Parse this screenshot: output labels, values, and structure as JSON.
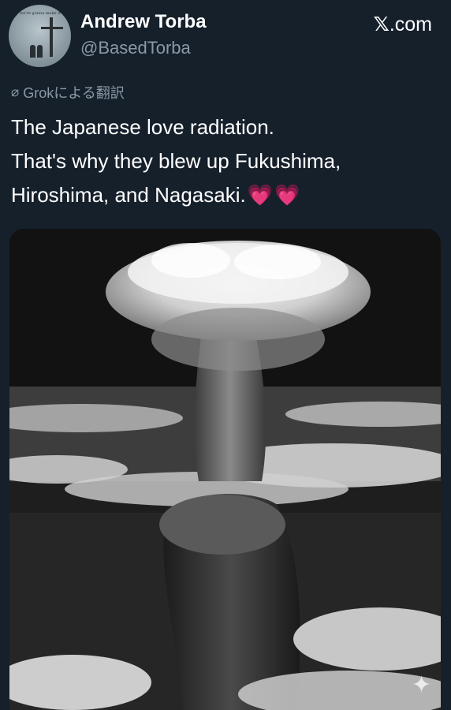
{
  "author": {
    "display_name": "Andrew Torba",
    "handle": "@BasedTorba",
    "avatar_icon": "avatar-cross-silhouettes-icon"
  },
  "brand": {
    "label": ".com",
    "icon": "x-logo-icon"
  },
  "translation": {
    "icon": "translate-slash-icon",
    "label": "Grokによる翻訳"
  },
  "tweet": {
    "lines": [
      "The Japanese love radiation.",
      "That's why they blew up Fukushima,",
      "Hiroshima, and Nagasaki."
    ],
    "emoji": [
      "💗",
      "💗"
    ]
  },
  "media": {
    "description_icon": "mushroom-cloud-photo",
    "badge_icon": "sparkle-icon"
  },
  "colors": {
    "background": "#15202b",
    "secondary_text": "#8b98a5",
    "heart": "#ff3e9f"
  }
}
